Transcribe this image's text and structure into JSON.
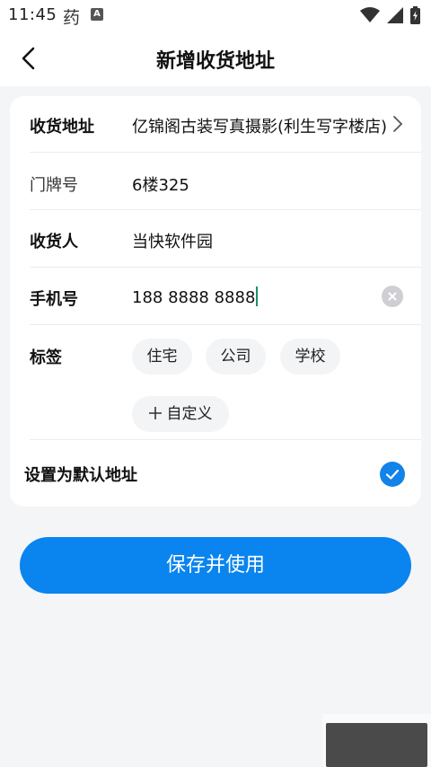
{
  "status_bar": {
    "time": "11:45",
    "app_glyph": "药",
    "notification_letter": "A",
    "icons": [
      "wifi-icon",
      "signal-icon",
      "battery-icon"
    ]
  },
  "header": {
    "title": "新增收货地址",
    "back_icon": "chevron-left-icon"
  },
  "form": {
    "address": {
      "label": "收货地址",
      "value": "亿锦阁古装写真摄影(利生写字楼店)"
    },
    "door": {
      "label": "门牌号",
      "value": "6楼325"
    },
    "recipient": {
      "label": "收货人",
      "value": "当快软件园"
    },
    "phone": {
      "label": "手机号",
      "value": "188 8888 8888"
    },
    "tags": {
      "label": "标签",
      "options": [
        "住宅",
        "公司",
        "学校"
      ],
      "custom_label": "自定义"
    },
    "default": {
      "label": "设置为默认地址",
      "checked": true
    }
  },
  "save_button": {
    "label": "保存并使用"
  },
  "colors": {
    "accent": "#0a84ee",
    "check": "#1283e8",
    "background": "#f4f5f7",
    "card": "#ffffff",
    "caret": "#1a8f6c"
  }
}
